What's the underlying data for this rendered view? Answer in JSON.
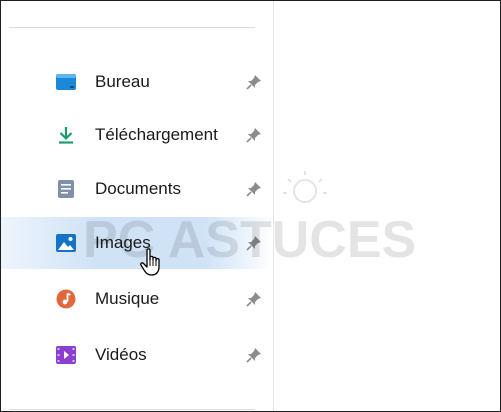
{
  "sidebar": {
    "items": [
      {
        "label": "Bureau",
        "icon": "desktop-icon",
        "pinned": true
      },
      {
        "label": "Téléchargement",
        "icon": "download-icon",
        "pinned": true
      },
      {
        "label": "Documents",
        "icon": "document-icon",
        "pinned": true
      },
      {
        "label": "Images",
        "icon": "pictures-icon",
        "pinned": true,
        "selected": true
      },
      {
        "label": "Musique",
        "icon": "music-icon",
        "pinned": true
      },
      {
        "label": "Vidéos",
        "icon": "videos-icon",
        "pinned": true
      }
    ]
  },
  "watermark": {
    "text": "PC ASTUCES"
  },
  "colors": {
    "selection": "#cde1f6",
    "desktop": "#1e88d8",
    "download": "#1a9e6b",
    "document": "#6b7c93",
    "pictures": "#1572c4",
    "music": "#e2683c",
    "videos": "#8a3fd1",
    "pin": "#8c8c8c"
  }
}
